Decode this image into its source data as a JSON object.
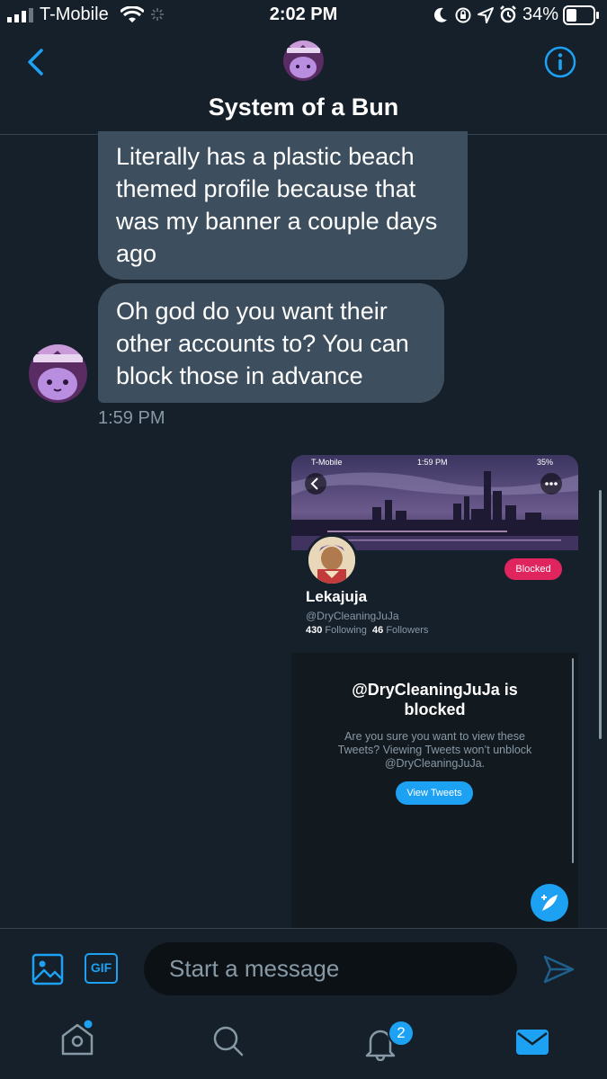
{
  "status_bar": {
    "carrier": "T-Mobile",
    "time": "2:02 PM",
    "battery": "34%"
  },
  "header": {
    "title": "System of a Bun"
  },
  "messages": [
    {
      "text": "Literally has a plastic beach themed profile because that was my banner a couple days ago"
    },
    {
      "text": "Oh god do you want their other accounts to? You can block those in advance"
    }
  ],
  "message_time": "1:59 PM",
  "shared_screenshot": {
    "status": {
      "carrier": "T-Mobile",
      "time": "1:59 PM",
      "battery": "35%"
    },
    "blocked_label": "Blocked",
    "profile_name": "Lekajuja",
    "handle": "@DryCleaningJuJa",
    "following_count": "430",
    "following_label": "Following",
    "followers_count": "46",
    "followers_label": "Followers",
    "blocked_title": "@DryCleaningJuJa is blocked",
    "blocked_body": "Are you sure you want to view these Tweets? Viewing Tweets won’t unblock @DryCleaningJuJa.",
    "view_tweets_label": "View Tweets"
  },
  "composer": {
    "placeholder": "Start a message",
    "gif_label": "GIF"
  },
  "tabbar": {
    "notifications_badge": "2"
  },
  "colors": {
    "background": "#15202b",
    "bubble": "#3d4f5f",
    "accent": "#1da1f2",
    "blocked": "#e0245e",
    "muted": "#8899a6"
  }
}
